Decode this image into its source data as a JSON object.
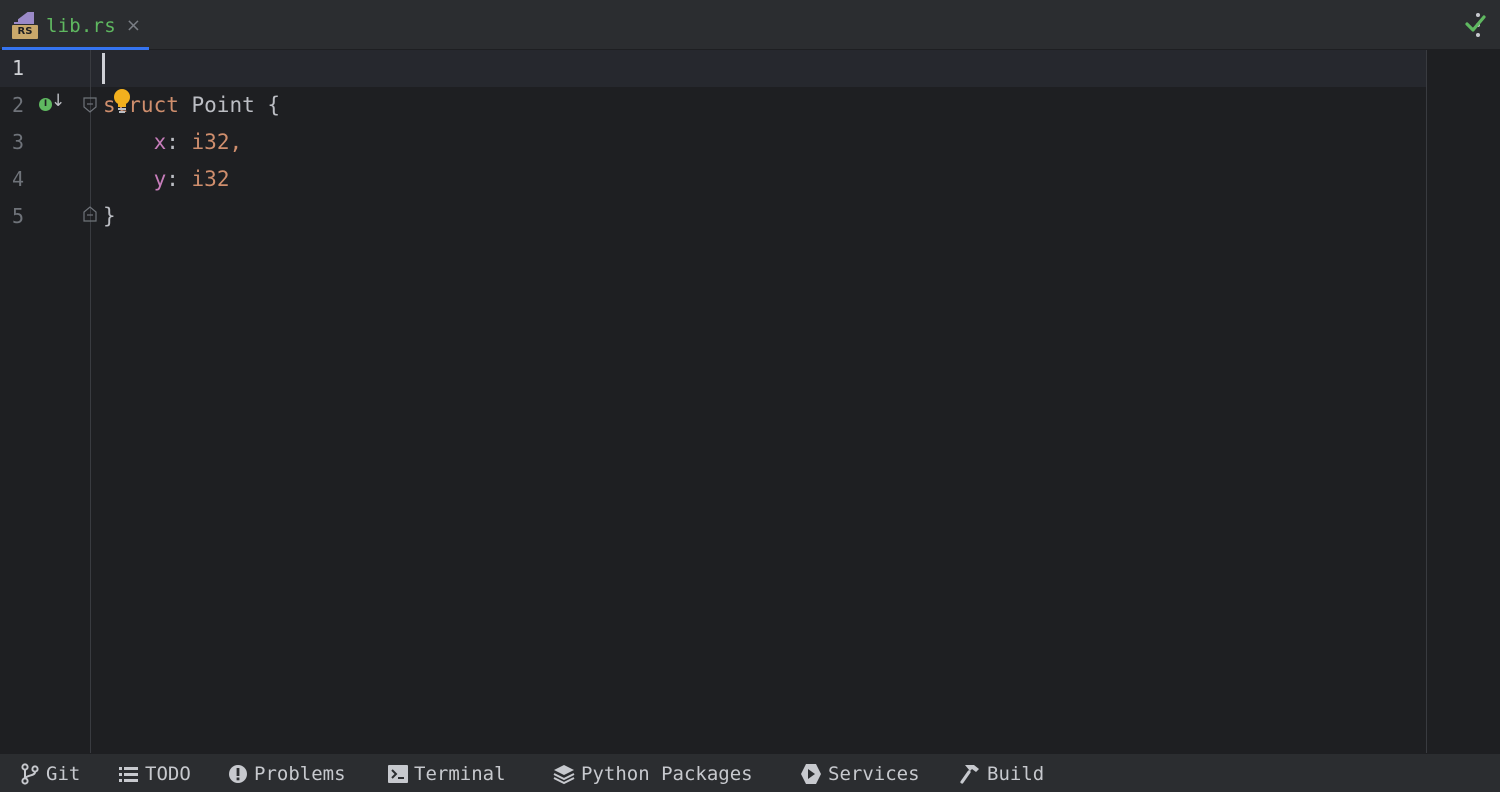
{
  "tab": {
    "file_name": "lib.rs",
    "badge": "RS",
    "close_glyph": "×"
  },
  "editor": {
    "current_line": 1,
    "line_numbers": [
      "1",
      "2",
      "3",
      "4",
      "5"
    ],
    "lines": [
      {
        "tokens": []
      },
      {
        "tokens": [
          {
            "text": "struct",
            "kind": "kw"
          },
          {
            "text": " ",
            "kind": "punct"
          },
          {
            "text": "Point",
            "kind": "ident"
          },
          {
            "text": " {",
            "kind": "punct"
          }
        ]
      },
      {
        "tokens": [
          {
            "text": "    ",
            "kind": "punct"
          },
          {
            "text": "x",
            "kind": "field"
          },
          {
            "text": ": ",
            "kind": "punct"
          },
          {
            "text": "i32,",
            "kind": "type"
          }
        ]
      },
      {
        "tokens": [
          {
            "text": "    ",
            "kind": "punct"
          },
          {
            "text": "y",
            "kind": "field"
          },
          {
            "text": ": ",
            "kind": "punct"
          },
          {
            "text": "i32",
            "kind": "type"
          }
        ]
      },
      {
        "tokens": [
          {
            "text": "}",
            "kind": "punct"
          }
        ]
      }
    ],
    "impl_badge": "I"
  },
  "toolwindows": [
    {
      "label": "Git",
      "icon": "git-branch-icon"
    },
    {
      "label": "TODO",
      "icon": "list-icon"
    },
    {
      "label": "Problems",
      "icon": "problems-icon"
    },
    {
      "label": "Terminal",
      "icon": "terminal-icon"
    },
    {
      "label": "Python Packages",
      "icon": "layers-icon"
    },
    {
      "label": "Services",
      "icon": "services-icon"
    },
    {
      "label": "Build",
      "icon": "hammer-icon"
    }
  ],
  "colors": {
    "accent": "#3574f0",
    "keyword": "#cf8e6d",
    "field": "#c77dbb",
    "inspection_ok": "#5fb860"
  }
}
